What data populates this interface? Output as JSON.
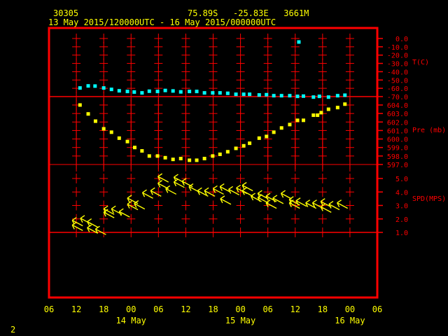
{
  "header": {
    "station_id": "30305",
    "location": "75.89S   -25.83E   3661M",
    "time_range": "13 May 2015/120000UTC - 16 May 2015/000000UTC"
  },
  "footer": {
    "page_number": "2"
  },
  "colors": {
    "frame": "#ff0000",
    "temperature": "#00ffff",
    "pressure": "#ffff00",
    "wind": "#ffff00",
    "text": "#ffff00"
  },
  "chart_data": {
    "type": "scatter",
    "x_unit": "hours since 13 May 06UTC",
    "x_range": [
      0,
      72
    ],
    "x_ticks": [
      "06",
      "12",
      "18",
      "00",
      "06",
      "12",
      "18",
      "00",
      "06",
      "12",
      "18",
      "00",
      "06"
    ],
    "date_labels": [
      {
        "label": "14 May",
        "hour": 18
      },
      {
        "label": "15 May",
        "hour": 42
      },
      {
        "label": "16 May",
        "hour": 66
      }
    ],
    "panels": [
      {
        "name": "temperature",
        "label": "T(C)",
        "ylim": [
          -70,
          0
        ],
        "ticks": [
          "0.0",
          "-10.0",
          "-20.0",
          "-30.0",
          "-40.0",
          "-50.0",
          "-60.0",
          "-70.0"
        ],
        "points": [
          [
            6.8,
            -59.6
          ],
          [
            8.6,
            -57.1
          ],
          [
            10.1,
            -57.3
          ],
          [
            12.0,
            -59.6
          ],
          [
            13.7,
            -61.3
          ],
          [
            15.4,
            -63.0
          ],
          [
            17.2,
            -63.8
          ],
          [
            18.7,
            -64.5
          ],
          [
            20.4,
            -65.5
          ],
          [
            22.0,
            -63.5
          ],
          [
            23.8,
            -63.8
          ],
          [
            25.5,
            -62.6
          ],
          [
            27.2,
            -63.2
          ],
          [
            28.9,
            -64.3
          ],
          [
            30.8,
            -63.8
          ],
          [
            32.4,
            -63.8
          ],
          [
            34.1,
            -65.5
          ],
          [
            35.9,
            -65.5
          ],
          [
            37.5,
            -65.5
          ],
          [
            39.2,
            -66.0
          ],
          [
            41.0,
            -67.2
          ],
          [
            42.7,
            -67.2
          ],
          [
            44.0,
            -67.2
          ],
          [
            46.1,
            -68.0
          ],
          [
            47.7,
            -67.7
          ],
          [
            49.3,
            -68.9
          ],
          [
            51.0,
            -68.9
          ],
          [
            52.8,
            -68.9
          ],
          [
            54.5,
            -69.7
          ],
          [
            54.8,
            -4.2
          ],
          [
            55.8,
            -69.4
          ],
          [
            58.0,
            -70.6
          ],
          [
            59.3,
            -69.7
          ],
          [
            61.3,
            -70.6
          ],
          [
            63.3,
            -68.9
          ],
          [
            64.9,
            -68.3
          ]
        ]
      },
      {
        "name": "pressure",
        "label": "Pre (mb)",
        "ylim": [
          597,
          604
        ],
        "ticks": [
          "604.0",
          "603.0",
          "602.0",
          "601.0",
          "600.0",
          "599.0",
          "598.0",
          "597.0"
        ],
        "points": [
          [
            6.8,
            604.0
          ],
          [
            8.6,
            602.95
          ],
          [
            10.2,
            602.1
          ],
          [
            12.0,
            601.2
          ],
          [
            13.7,
            600.8
          ],
          [
            15.4,
            600.1
          ],
          [
            17.2,
            599.7
          ],
          [
            18.8,
            599.0
          ],
          [
            20.4,
            598.6
          ],
          [
            22.0,
            598.0
          ],
          [
            23.8,
            598.0
          ],
          [
            25.5,
            597.8
          ],
          [
            27.2,
            597.6
          ],
          [
            28.9,
            597.7
          ],
          [
            30.8,
            597.5
          ],
          [
            32.4,
            597.5
          ],
          [
            34.1,
            597.7
          ],
          [
            35.9,
            598.0
          ],
          [
            37.5,
            598.2
          ],
          [
            39.2,
            598.5
          ],
          [
            41.0,
            598.9
          ],
          [
            42.7,
            599.2
          ],
          [
            44.0,
            599.5
          ],
          [
            46.1,
            600.1
          ],
          [
            47.7,
            600.3
          ],
          [
            49.3,
            600.8
          ],
          [
            51.0,
            601.3
          ],
          [
            52.8,
            601.7
          ],
          [
            54.5,
            602.2
          ],
          [
            55.8,
            602.2
          ],
          [
            58.0,
            602.8
          ],
          [
            58.9,
            602.8
          ],
          [
            59.7,
            603.1
          ],
          [
            61.3,
            603.5
          ],
          [
            63.3,
            603.7
          ],
          [
            64.9,
            604.1
          ]
        ]
      },
      {
        "name": "wind",
        "label": "SPD(MPS)",
        "ylim": [
          1,
          5
        ],
        "ticks": [
          "5.0",
          "4.0",
          "3.0",
          "2.0",
          "1.0"
        ],
        "points": [
          [
            5.1,
            1.9
          ],
          [
            5.1,
            1.55
          ],
          [
            6.9,
            2.05
          ],
          [
            8.4,
            1.8
          ],
          [
            8.4,
            1.35
          ],
          [
            10.2,
            1.25
          ],
          [
            12.0,
            2.75
          ],
          [
            12.0,
            2.5
          ],
          [
            13.7,
            2.75
          ],
          [
            15.4,
            2.55
          ],
          [
            17.2,
            3.55
          ],
          [
            17.2,
            3.1
          ],
          [
            18.7,
            3.15
          ],
          [
            20.5,
            3.95
          ],
          [
            22.3,
            4.1
          ],
          [
            23.9,
            5.15
          ],
          [
            23.9,
            4.65
          ],
          [
            25.6,
            4.25
          ],
          [
            27.4,
            5.1
          ],
          [
            27.4,
            4.75
          ],
          [
            29.2,
            4.8
          ],
          [
            30.7,
            4.4
          ],
          [
            32.6,
            4.1
          ],
          [
            34.1,
            4.1
          ],
          [
            36.0,
            4.25
          ],
          [
            37.5,
            4.4
          ],
          [
            37.6,
            3.5
          ],
          [
            39.4,
            4.2
          ],
          [
            41.1,
            4.3
          ],
          [
            42.4,
            4.5
          ],
          [
            42.4,
            4.1
          ],
          [
            44.3,
            3.7
          ],
          [
            45.8,
            3.9
          ],
          [
            45.8,
            3.6
          ],
          [
            47.6,
            3.7
          ],
          [
            47.6,
            3.2
          ],
          [
            49.1,
            3.55
          ],
          [
            50.9,
            3.9
          ],
          [
            52.7,
            3.45
          ],
          [
            52.7,
            3.2
          ],
          [
            54.2,
            3.35
          ],
          [
            56.3,
            3.2
          ],
          [
            57.8,
            3.2
          ],
          [
            59.6,
            3.3
          ],
          [
            59.6,
            2.9
          ],
          [
            61.4,
            3.1
          ],
          [
            63.2,
            3.2
          ]
        ]
      }
    ]
  }
}
